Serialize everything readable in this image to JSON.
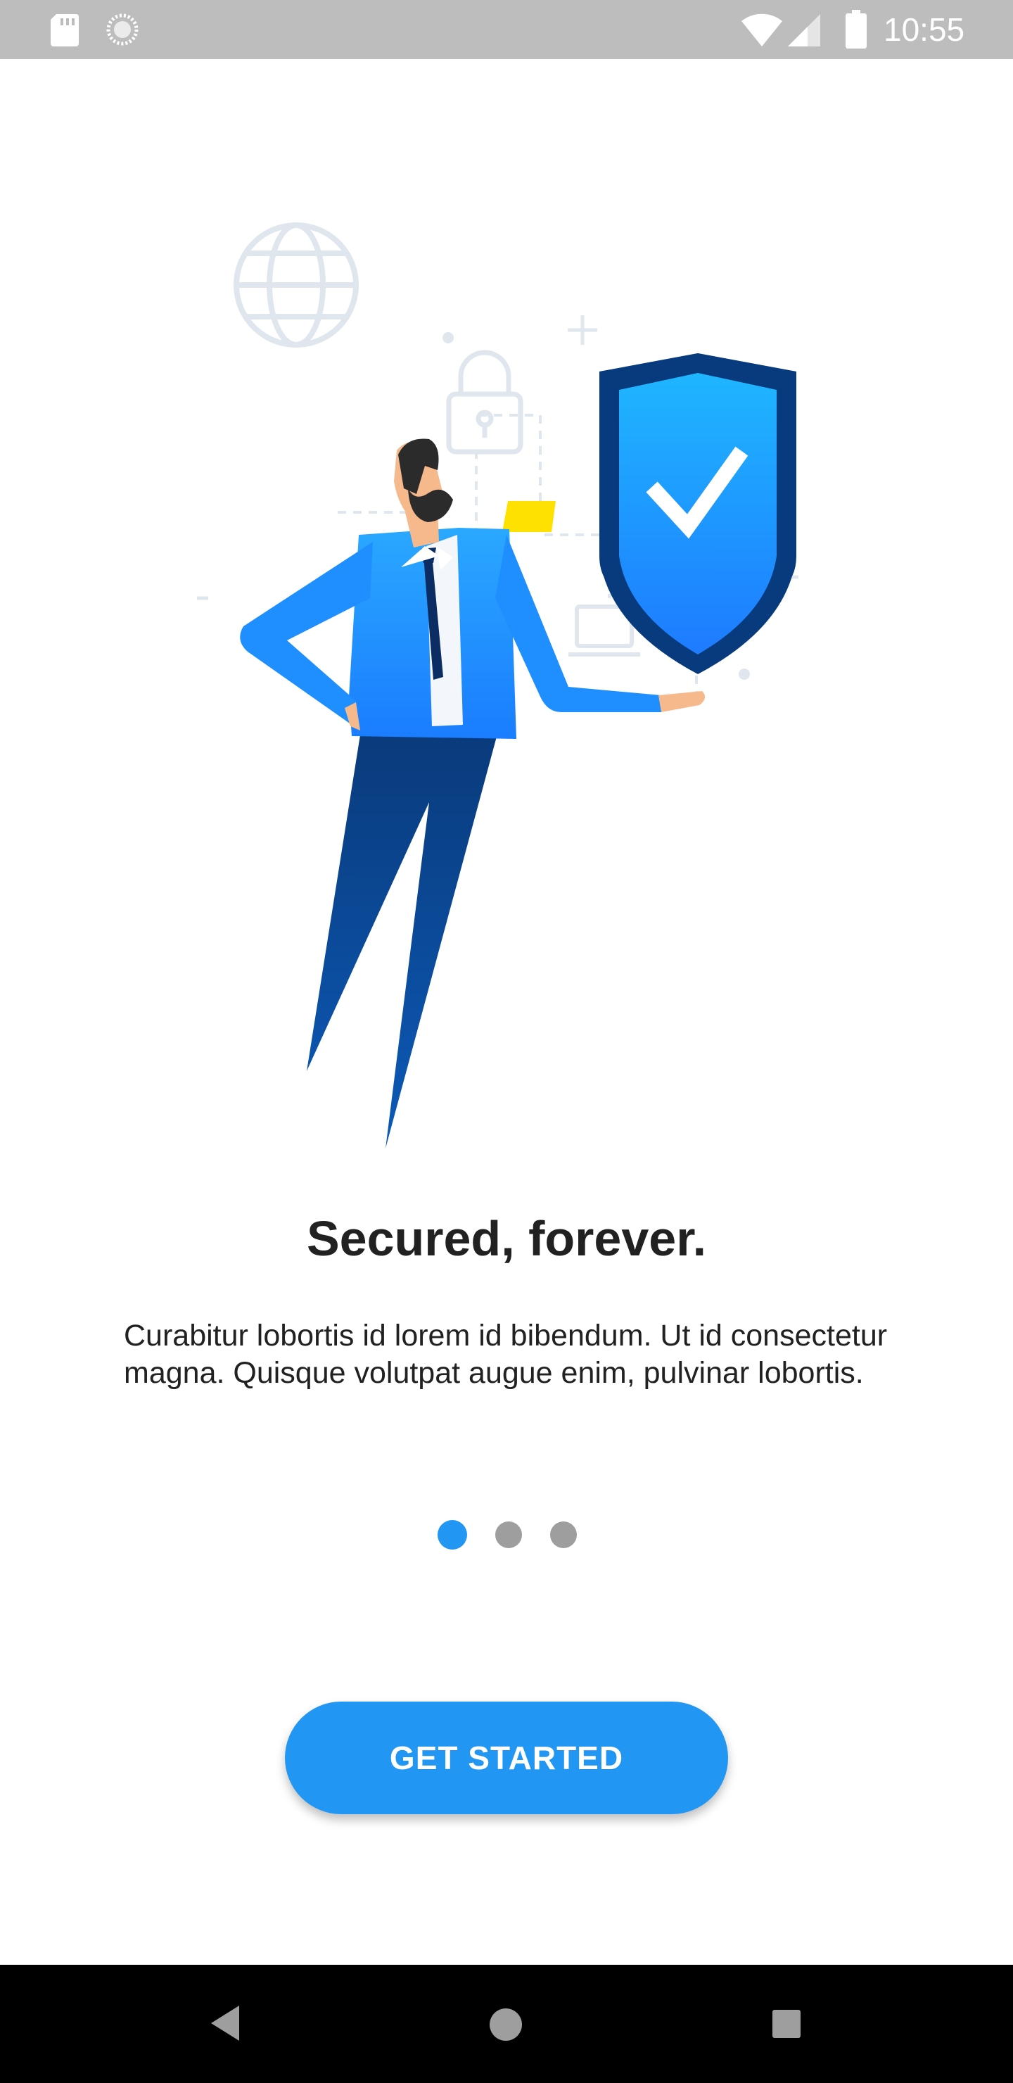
{
  "status_bar": {
    "time": "10:55",
    "icons": [
      "sd-card-icon",
      "sync-icon",
      "wifi-icon",
      "cell-signal-icon",
      "battery-icon"
    ]
  },
  "onboarding": {
    "title": "Secured, forever.",
    "description": "Curabitur lobortis id lorem id bibendum. Ut id consectetur magna. Quisque volutpat augue enim, pulvinar lobortis.",
    "pager": {
      "page_count": 3,
      "active_index": 0
    },
    "cta_label": "GET STARTED"
  },
  "colors": {
    "accent": "#2196f3",
    "inactive_dot": "#9e9e9e",
    "status_bar": "#bdbdbd",
    "nav_bar": "#000000",
    "text": "#212121"
  },
  "nav_bar": {
    "icons": [
      "back-icon",
      "home-icon",
      "recents-icon"
    ]
  }
}
